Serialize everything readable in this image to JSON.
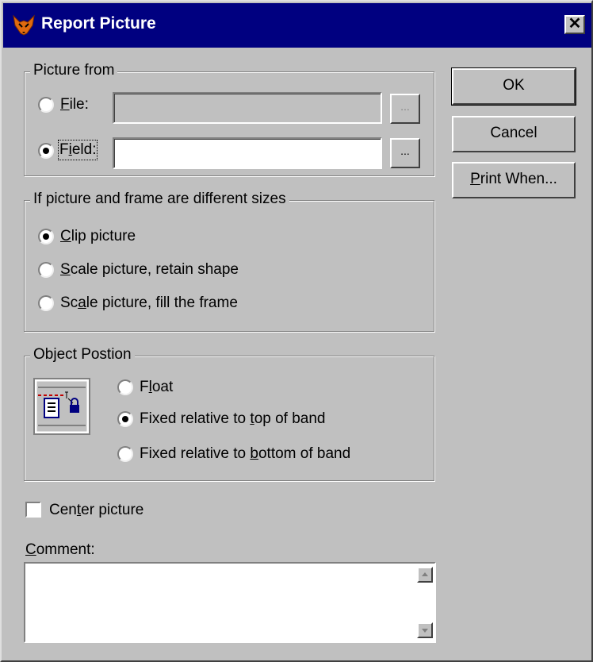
{
  "window": {
    "title": "Report Picture",
    "title_icon": "fox-app-icon",
    "close_glyph": "✕"
  },
  "picture_from": {
    "legend": "Picture from",
    "file_label": "File:",
    "field_label": "Field:",
    "file_value": "",
    "field_value": "",
    "browse_label": "...",
    "selected": "field"
  },
  "sizing": {
    "legend": "If picture and frame are different sizes",
    "options": [
      "Clip picture",
      "Scale picture, retain shape",
      "Scale picture, fill the frame"
    ],
    "selected_index": 0
  },
  "position": {
    "legend": "Object Postion",
    "options": [
      "Float",
      "Fixed relative to top of band",
      "Fixed relative to bottom of band"
    ],
    "selected_index": 1
  },
  "center_picture": {
    "label": "Center picture",
    "checked": false
  },
  "comment": {
    "label": "Comment:",
    "value": ""
  },
  "buttons": {
    "ok": "OK",
    "cancel": "Cancel",
    "print_when": "Print When..."
  }
}
